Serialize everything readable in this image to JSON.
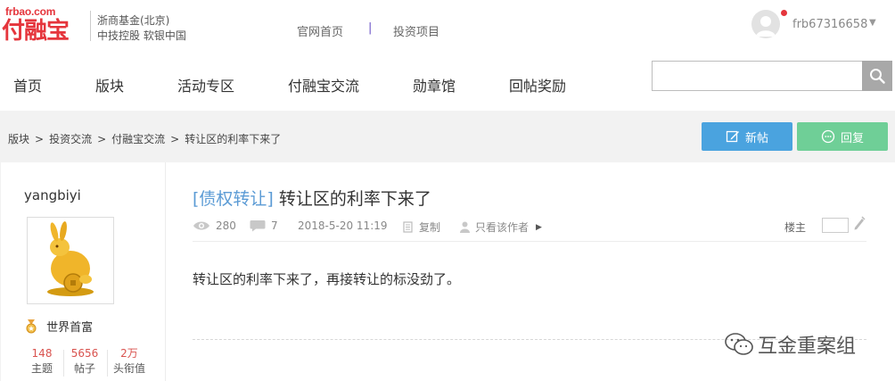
{
  "header": {
    "logo_url": "frbao.com",
    "logo_name": "付融宝",
    "logo_sub1": "浙商基金(北京)",
    "logo_sub2": "中技控股  软银中国",
    "links": [
      "官网首页",
      "投资项目"
    ],
    "link_separator": "|",
    "username": "frb67316658"
  },
  "nav": {
    "items": [
      "首页",
      "版块",
      "活动专区",
      "付融宝交流",
      "勋章馆",
      "回帖奖励"
    ],
    "search_placeholder": ""
  },
  "breadcrumb": [
    "版块",
    ">",
    "投资交流",
    ">",
    "付融宝交流",
    ">",
    "转让区的利率下来了"
  ],
  "buttons": {
    "new_post": "新帖",
    "reply": "回复"
  },
  "author": {
    "name": "yangbiyi",
    "medal": "世界首富",
    "stats": [
      {
        "value": "148",
        "label": "主题"
      },
      {
        "value": "5656",
        "label": "帖子"
      },
      {
        "value": "2万",
        "label": "头衔值"
      }
    ]
  },
  "post": {
    "tag": "[债权转让]",
    "title": "转让区的利率下来了",
    "views": "280",
    "replies": "7",
    "date": "2018-5-20 11:19",
    "copy": "复制",
    "only_author": "只看该作者",
    "floor": "楼主",
    "content": "转让区的利率下来了，再接转让的标没劲了。"
  },
  "watermark": "互金重案组",
  "colors": {
    "brand_red": "#e5353c",
    "new_button": "#4aa3df",
    "reply_button": "#6fcf97",
    "tag_blue": "#5b9bd5",
    "stat_red": "#d9534f"
  }
}
